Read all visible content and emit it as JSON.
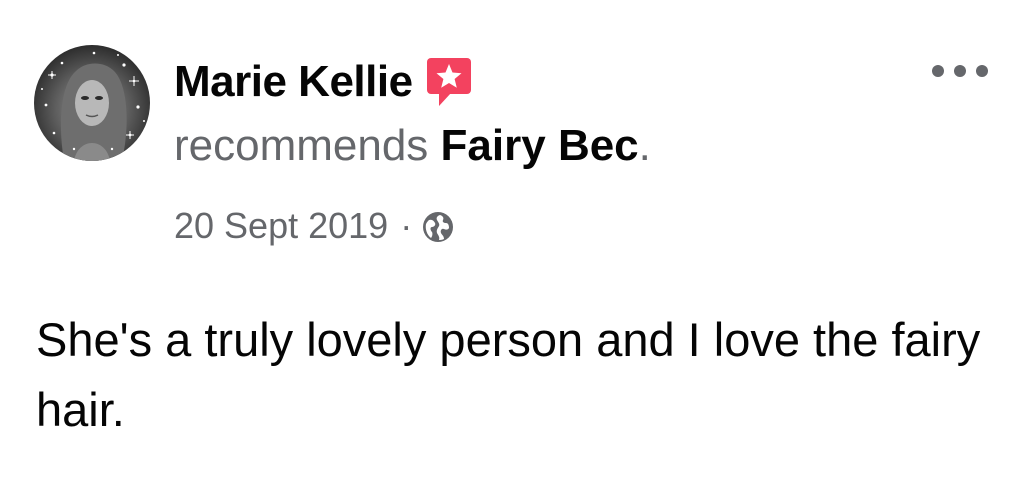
{
  "post": {
    "author_name": "Marie Kellie",
    "recommendation_verb": "recommends",
    "page_name": "Fairy Bec",
    "page_name_suffix": ".",
    "date": "20 Sept 2019",
    "separator": "·",
    "audience_icon": "globe-icon",
    "more_icon": "more-options-icon",
    "badge_icon": "recommendation-star-icon",
    "text": "She's a truly lovely person and I love the fairy hair."
  },
  "colors": {
    "primary_text": "#050505",
    "secondary_text": "#65676b",
    "badge": "#f3425f"
  }
}
